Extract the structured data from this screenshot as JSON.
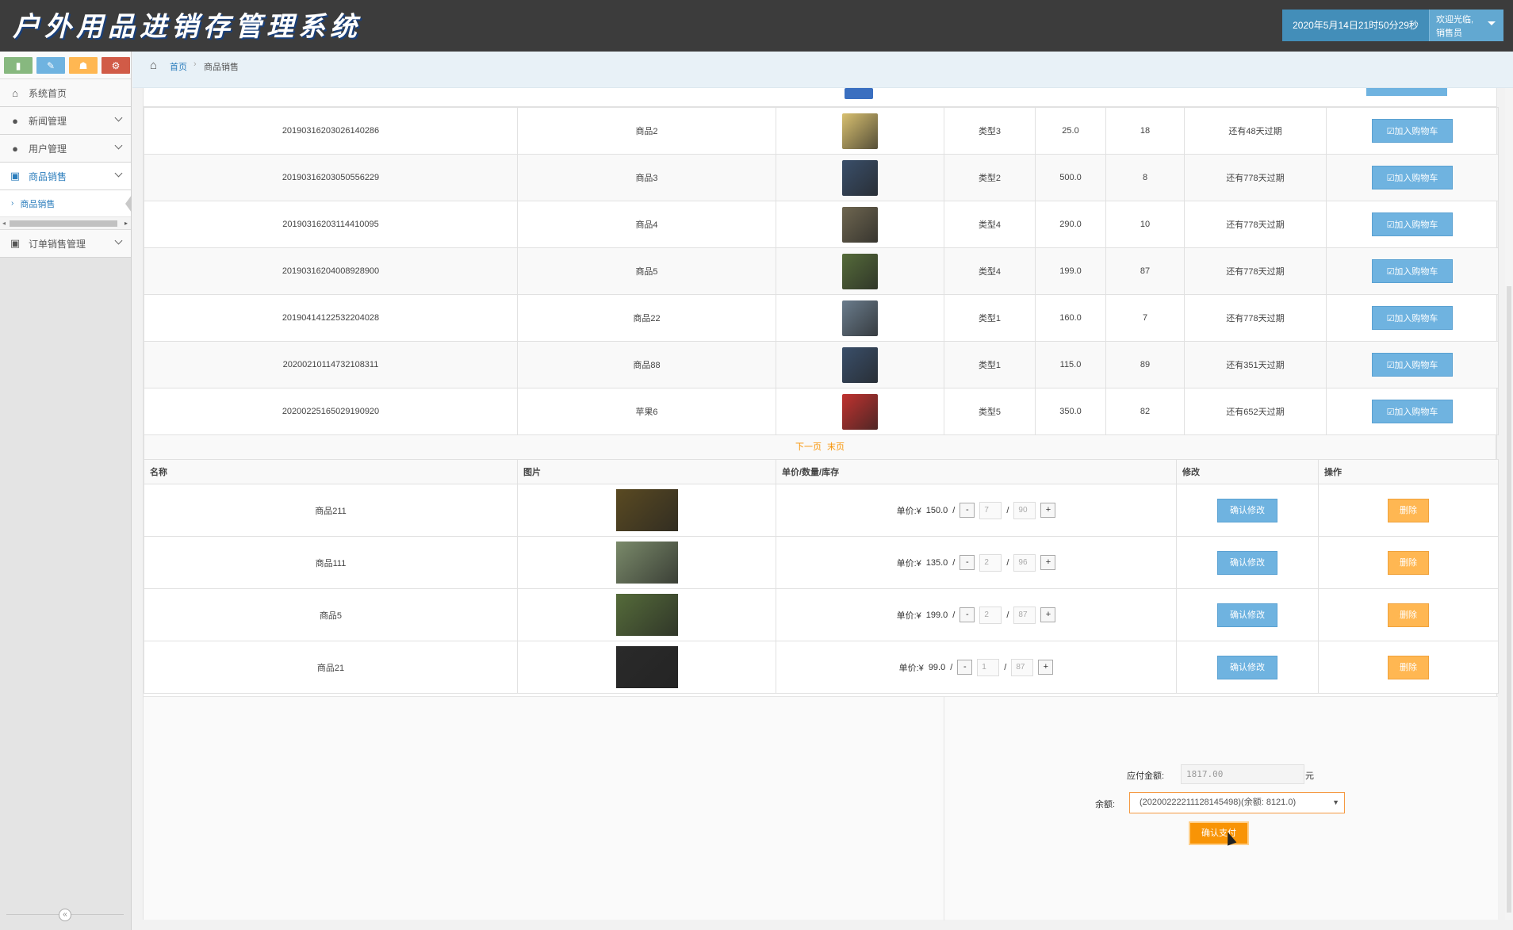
{
  "header": {
    "title": "户外用品进销存管理系统",
    "datetime": "2020年5月14日21时50分29秒",
    "welcome_line1": "欢迎光临,",
    "welcome_line2": "销售员"
  },
  "sidebar": {
    "items": [
      {
        "label": "系统首页",
        "icon": "home-icon"
      },
      {
        "label": "新闻管理",
        "icon": "user-icon"
      },
      {
        "label": "用户管理",
        "icon": "user-icon"
      },
      {
        "label": "商品销售",
        "icon": "picture-icon"
      },
      {
        "label": "订单销售管理",
        "icon": "picture-icon"
      }
    ],
    "sub_item": "商品销售"
  },
  "breadcrumb": {
    "home": "首页",
    "current": "商品销售"
  },
  "products": [
    {
      "id": "20190316203026140286",
      "name": "商品2",
      "type": "类型3",
      "price": "25.0",
      "stock": "18",
      "expiry": "还有48天过期",
      "color": "#d8c070"
    },
    {
      "id": "20190316203050556229",
      "name": "商品3",
      "type": "类型2",
      "price": "500.0",
      "stock": "8",
      "expiry": "还有778天过期",
      "color": "#3a4f6a"
    },
    {
      "id": "20190316203114410095",
      "name": "商品4",
      "type": "类型4",
      "price": "290.0",
      "stock": "10",
      "expiry": "还有778天过期",
      "color": "#6e6650"
    },
    {
      "id": "20190316204008928900",
      "name": "商品5",
      "type": "类型4",
      "price": "199.0",
      "stock": "87",
      "expiry": "还有778天过期",
      "color": "#556b3a"
    },
    {
      "id": "20190414122532204028",
      "name": "商品22",
      "type": "类型1",
      "price": "160.0",
      "stock": "7",
      "expiry": "还有778天过期",
      "color": "#6a7c8c"
    },
    {
      "id": "20200210114732108311",
      "name": "商品88",
      "type": "类型1",
      "price": "115.0",
      "stock": "89",
      "expiry": "还有351天过期",
      "color": "#3a4f6a"
    },
    {
      "id": "20200225165029190920",
      "name": "苹果6",
      "type": "类型5",
      "price": "350.0",
      "stock": "82",
      "expiry": "还有652天过期",
      "color": "#c0322f"
    }
  ],
  "add_to_cart_label": "☑加入购物车",
  "pager": {
    "next": "下一页",
    "last": "末页"
  },
  "cart": {
    "headers": {
      "name": "名称",
      "image": "图片",
      "price_qty": "单价/数量/库存",
      "edit": "修改",
      "action": "操作"
    },
    "price_prefix": "单价:¥",
    "confirm_label": "确认修改",
    "delete_label": "删除",
    "rows": [
      {
        "name": "商品211",
        "price": "150.0",
        "qty": "7",
        "stock": "90",
        "color": "#5a4a22"
      },
      {
        "name": "商品111",
        "price": "135.0",
        "qty": "2",
        "stock": "96",
        "color": "#7a8a6a"
      },
      {
        "name": "商品5",
        "price": "199.0",
        "qty": "2",
        "stock": "87",
        "color": "#556b3a"
      },
      {
        "name": "商品21",
        "price": "99.0",
        "qty": "1",
        "stock": "87",
        "color": "#2a2a2a"
      }
    ]
  },
  "payment": {
    "amount_label": "应付金额:",
    "amount": "1817.00",
    "unit": "元",
    "balance_label": "余额:",
    "balance_option": "(20200222211128145498)(余额: 8121.0)",
    "pay_label": "确认支付"
  }
}
